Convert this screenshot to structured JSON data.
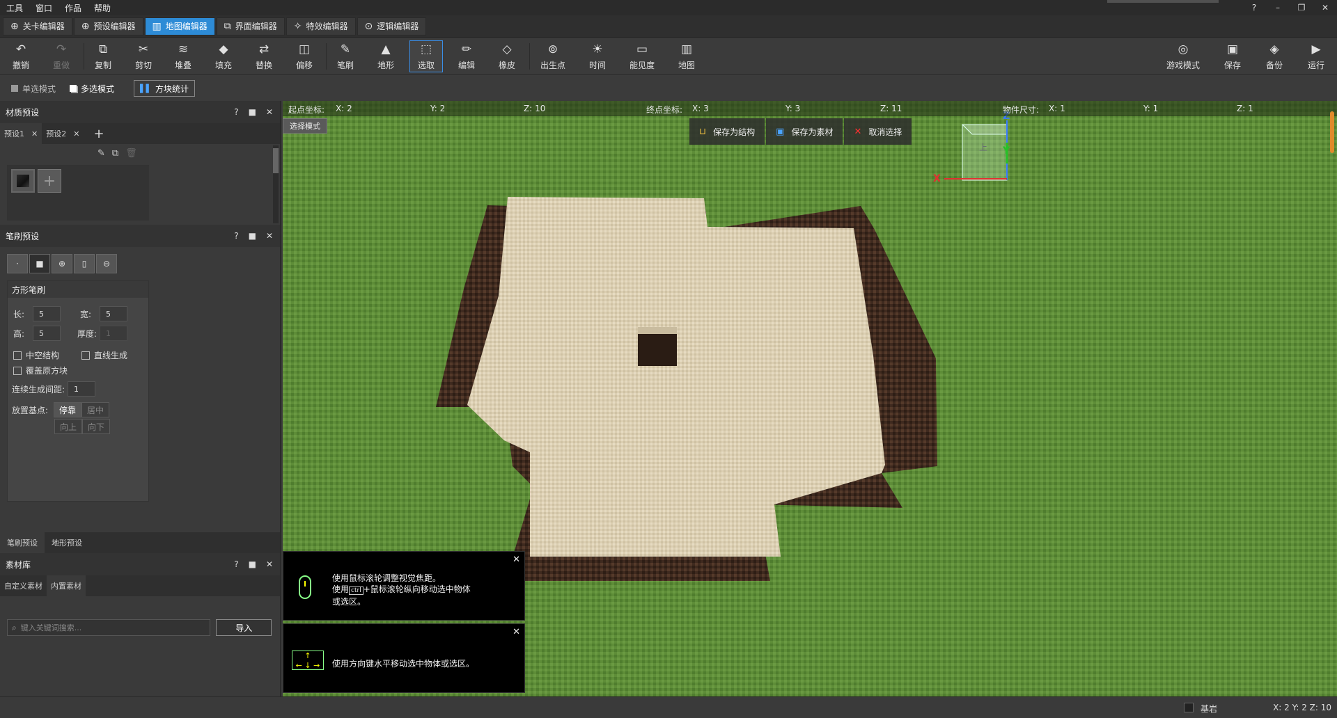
{
  "menu": [
    "工具",
    "窗口",
    "作品",
    "帮助"
  ],
  "window_controls": [
    "?̲",
    "–",
    "❐",
    "✕"
  ],
  "editor_tabs": [
    {
      "label": "关卡编辑器",
      "icon": "level-icon",
      "active": false
    },
    {
      "label": "预设编辑器",
      "icon": "preset-icon",
      "active": false
    },
    {
      "label": "地图编辑器",
      "icon": "map-icon",
      "active": true
    },
    {
      "label": "界面编辑器",
      "icon": "ui-icon",
      "active": false
    },
    {
      "label": "特效编辑器",
      "icon": "effect-icon",
      "active": false
    },
    {
      "label": "逻辑编辑器",
      "icon": "logic-icon",
      "active": false
    }
  ],
  "toolbar": {
    "undo": "撤销",
    "redo": "重做",
    "copy": "复制",
    "cut": "剪切",
    "stack": "堆叠",
    "fill": "填充",
    "replace": "替换",
    "offset": "偏移",
    "brush": "笔刷",
    "terrain": "地形",
    "select": "选取",
    "edit": "编辑",
    "eraser": "橡皮",
    "spawn": "出生点",
    "time": "时间",
    "visibility": "能见度",
    "map": "地图",
    "game_mode": "游戏模式",
    "save": "保存",
    "backup": "备份",
    "run": "运行"
  },
  "modebar": {
    "single": "单选模式",
    "multi": "多选模式",
    "stats": "方块统计"
  },
  "material_panel": {
    "title": "材质预设",
    "tabs": [
      "预设1",
      "预设2"
    ]
  },
  "brush_panel": {
    "title": "笔刷预设",
    "box_title": "方形笔刷",
    "length_label": "长:",
    "length": "5",
    "width_label": "宽:",
    "width": "5",
    "height_label": "高:",
    "height": "5",
    "thickness_label": "厚度:",
    "thickness": "1",
    "hollow": "中空结构",
    "line": "直线生成",
    "cover": "覆盖原方块",
    "interval_label": "连续生成间距:",
    "interval": "1",
    "anchor_label": "放置基点:",
    "anchor_buttons": [
      "停靠",
      "居中",
      "向上",
      "向下"
    ]
  },
  "bottom_tabs": [
    "笔刷预设",
    "地形预设"
  ],
  "library": {
    "title": "素材库",
    "tabs": [
      "自定义素材",
      "内置素材"
    ],
    "search_placeholder": "键入关键词搜索...",
    "import": "导入"
  },
  "coords": {
    "start_label": "起点坐标:",
    "sx": "X:  2",
    "sy": "Y:  2",
    "sz": "Z:  10",
    "end_label": "终点坐标:",
    "ex": "X:  3",
    "ey": "Y:  3",
    "ez": "Z:  11",
    "size_label": "物件尺寸:",
    "wx": "X:  1",
    "wy": "Y:  1",
    "wz": "Z:  1"
  },
  "viewport": {
    "select_mode": "选择模式",
    "save_structure": "保存为结构",
    "save_asset": "保存为素材",
    "cancel_select": "取消选择",
    "gizmo_top": "上",
    "axis_x": "X",
    "axis_y": "Y",
    "axis_z": "Z"
  },
  "hints": {
    "h1_line1": "使用鼠标滚轮调整视觉焦距。",
    "h1_line2a": "使用",
    "h1_key": "ctrl",
    "h1_line2b": "+鼠标滚轮纵向移动选中物体",
    "h1_line3": "或选区。",
    "h2": "使用方向键水平移动选中物体或选区。"
  },
  "status": {
    "block_name": "基岩",
    "xyz": "X: 2  Y: 2  Z: 10"
  },
  "colors": {
    "accent": "#2d8bd6",
    "sand": "#dcd0b4",
    "dirt": "#4a3124",
    "grass": "#5f8f3a"
  }
}
